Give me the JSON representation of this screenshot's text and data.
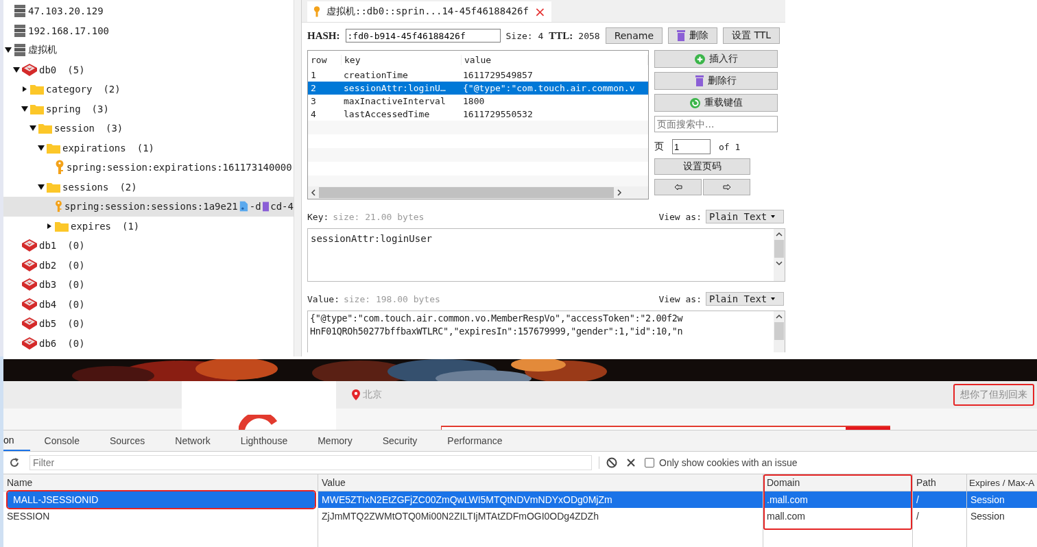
{
  "tree": [
    {
      "kind": "server",
      "label": "47.103.20.129",
      "selected": false
    },
    {
      "kind": "server",
      "label": "192.168.17.100",
      "selected": false
    },
    {
      "kind": "server",
      "label": "虚拟机",
      "expanded": true,
      "selected": false,
      "children": [
        {
          "kind": "db",
          "label": "db0",
          "count": "(5)",
          "expanded": true,
          "selected": false,
          "children": [
            {
              "kind": "folder",
              "label": "category",
              "count": "(2)",
              "expanded": false,
              "selected": false
            },
            {
              "kind": "folder",
              "label": "spring",
              "count": "(3)",
              "expanded": true,
              "selected": false,
              "children": [
                {
                  "kind": "folder",
                  "label": "session",
                  "count": "(3)",
                  "expanded": true,
                  "selected": false,
                  "children": [
                    {
                      "kind": "folder",
                      "label": "expirations",
                      "count": "(1)",
                      "expanded": true,
                      "selected": false,
                      "children": [
                        {
                          "kind": "key",
                          "label": "spring:session:expirations:161173140000",
                          "selected": false
                        }
                      ]
                    },
                    {
                      "kind": "folder",
                      "label": "sessions",
                      "count": "(2)",
                      "expanded": true,
                      "selected": false,
                      "children": [
                        {
                          "kind": "key",
                          "label": "spring:session:sessions:1a9e21",
                          "tail": [
                            "-d",
                            "cd-4"
                          ],
                          "selected": true
                        },
                        {
                          "kind": "folder",
                          "label": "expires",
                          "count": "(1)",
                          "expanded": false,
                          "selected": false
                        }
                      ]
                    }
                  ]
                }
              ]
            }
          ]
        },
        {
          "kind": "db",
          "label": "db1",
          "count": "(0)",
          "selected": false
        },
        {
          "kind": "db",
          "label": "db2",
          "count": "(0)",
          "selected": false
        },
        {
          "kind": "db",
          "label": "db3",
          "count": "(0)",
          "selected": false
        },
        {
          "kind": "db",
          "label": "db4",
          "count": "(0)",
          "selected": false
        },
        {
          "kind": "db",
          "label": "db5",
          "count": "(0)",
          "selected": false
        },
        {
          "kind": "db",
          "label": "db6",
          "count": "(0)",
          "selected": false
        }
      ]
    }
  ],
  "key_tab": {
    "title": "虚拟机::db0::sprin...14-45f46188426f",
    "close": "×"
  },
  "hash": {
    "label": "HASH:",
    "value": ":fd0-b914-45f46188426f",
    "size": "Size: 4",
    "ttl_label": "TTL:",
    "ttl": "2058",
    "buttons": [
      {
        "label": "Rename"
      },
      {
        "label": "删除"
      },
      {
        "label": "设置 TTL"
      }
    ]
  },
  "table": {
    "columns": [
      "row",
      "key",
      "value"
    ],
    "rows": [
      {
        "row": "1",
        "key": "creationTime",
        "value": "1611729549857",
        "selected": false
      },
      {
        "row": "2",
        "key": "sessionAttr:loginU…",
        "value": "{\"@type\":\"com.touch.air.common.v",
        "selected": true
      },
      {
        "row": "3",
        "key": "maxInactiveInterval",
        "value": "1800",
        "selected": false
      },
      {
        "row": "4",
        "key": "lastAccessedTime",
        "value": "1611729550532",
        "selected": false
      }
    ]
  },
  "side": {
    "buttons": [
      {
        "label": "插入行"
      },
      {
        "label": "删除行"
      },
      {
        "label": "重载键值"
      }
    ],
    "search_placeholder": "页面搜索中...",
    "page_label": "页",
    "page": "1",
    "of": "of 1",
    "set_page": "设置页码"
  },
  "key_section": {
    "label": "Key:",
    "hint": "size: 21.00 bytes",
    "view_as": "View as:",
    "format": "Plain Text",
    "value": "sessionAttr:loginUser"
  },
  "value_section": {
    "label": "Value:",
    "hint": "size: 198.00 bytes",
    "view_as": "View as:",
    "format": "Plain Text",
    "lines": [
      "{\"@type\":\"com.touch.air.common.vo.MemberRespVo\",\"accessToken\":\"2.00f2w",
      "HnF01QROh50277bffbaxWTLRC\",\"expiresIn\":157679999,\"gender\":1,\"id\":10,\"n"
    ]
  },
  "site": {
    "location": "北京",
    "user": {
      "label": "想你了但别回来",
      "highlighted": true
    }
  },
  "devtools": {
    "tabs": [
      {
        "label": "on",
        "selected": true
      },
      {
        "label": "Console",
        "selected": false
      },
      {
        "label": "Sources",
        "selected": false
      },
      {
        "label": "Network",
        "selected": false
      },
      {
        "label": "Lighthouse",
        "selected": false
      },
      {
        "label": "Memory",
        "selected": false
      },
      {
        "label": "Security",
        "selected": false
      },
      {
        "label": "Performance",
        "selected": false
      }
    ],
    "filter_placeholder": "Filter",
    "issue_filter": {
      "label": "Only show cookies with an issue",
      "checked": false
    },
    "columns": [
      {
        "label": "Name",
        "highlighted": false
      },
      {
        "label": "Value",
        "highlighted": false
      },
      {
        "label": "Domain",
        "highlighted": true
      },
      {
        "label": "Path",
        "highlighted": false
      },
      {
        "label": "Expires / Max-A",
        "highlighted": false
      }
    ],
    "rows": [
      {
        "cells": [
          "MALL-JSESSIONID",
          "MWE5ZTIxN2EtZGFjZC00ZmQwLWI5MTQtNDVmNDYxODg0MjZm",
          ".mall.com",
          "/",
          "Session"
        ],
        "selected": true,
        "name_highlighted": true
      },
      {
        "cells": [
          "SESSION",
          "ZjJmMTQ2ZWMtOTQ0Mi00N2ZILTIjMTAtZDFmOGI0ODg4ZDZh",
          "mall.com",
          "/",
          "Session"
        ],
        "selected": false,
        "name_highlighted": false
      }
    ]
  }
}
